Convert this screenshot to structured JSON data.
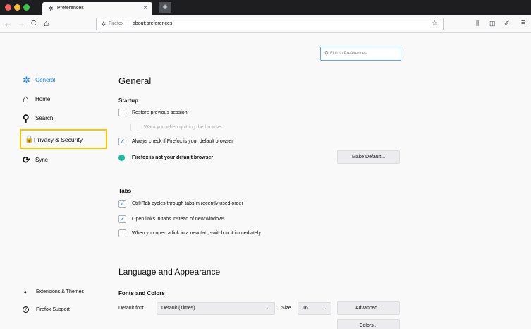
{
  "window": {
    "tab_title": "Preferences",
    "tab_favicon": "gear-icon",
    "tab_close": "×",
    "new_tab": "+"
  },
  "toolbar": {
    "back": "←",
    "forward": "→",
    "reload": "C",
    "home": "⌂",
    "url_identity": "Firefox",
    "url": "about:preferences",
    "bookmark_star": "☆",
    "library": "⫼",
    "sidebar": "◫",
    "customize": "✐",
    "menu": "≡"
  },
  "search": {
    "placeholder": "Find in Preferences",
    "icon": "search-icon"
  },
  "sidebar": {
    "items": [
      {
        "label": "General",
        "icon": "gear-icon",
        "glyph": "✲"
      },
      {
        "label": "Home",
        "icon": "home-icon",
        "glyph": "⌂"
      },
      {
        "label": "Search",
        "icon": "search-icon",
        "glyph": "⚲"
      },
      {
        "label": "Privacy & Security",
        "icon": "lock-icon",
        "glyph": "🔒"
      },
      {
        "label": "Sync",
        "icon": "sync-icon",
        "glyph": "⟳"
      }
    ],
    "footer": [
      {
        "label": "Extensions & Themes",
        "icon": "puzzle-icon",
        "glyph": "✦"
      },
      {
        "label": "Firefox Support",
        "icon": "help-icon",
        "glyph": "?"
      }
    ]
  },
  "main": {
    "title": "General",
    "startup": {
      "heading": "Startup",
      "restore_session": "Restore previous session",
      "warn_on_quit": "Warn you when quitting the browser",
      "default_check": "Always check if Firefox is your default browser",
      "not_default": "Firefox is not your default browser",
      "make_default": "Make Default..."
    },
    "tabs": {
      "heading": "Tabs",
      "ctrl_tab": "Ctrl+Tab cycles through tabs in recently used order",
      "open_links": "Open links in tabs instead of new windows",
      "switch_to_new": "When you open a link in a new tab, switch to it immediately"
    },
    "language": {
      "title": "Language and Appearance",
      "fonts_heading": "Fonts and Colors",
      "default_font_label": "Default font",
      "default_font_value": "Default (Times)",
      "size_label": "Size",
      "size_value": "16",
      "advanced": "Advanced...",
      "colors": "Colors..."
    },
    "checkmark": "✓",
    "chevron": "⌄"
  },
  "colors": {
    "accent": "#0a84ff",
    "highlight_border": "#f7c600",
    "info_dot": "#12bc9f"
  }
}
